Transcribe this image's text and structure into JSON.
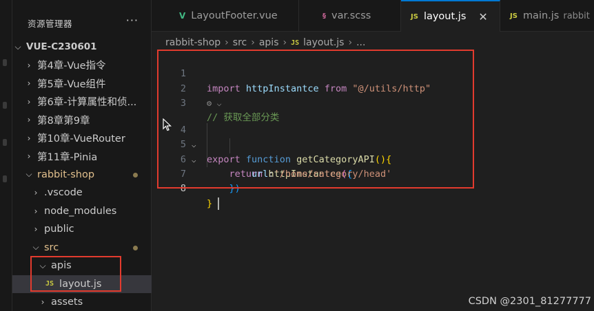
{
  "sidebar": {
    "title": "资源管理器",
    "more": "···",
    "project": "VUE-C230601",
    "items": [
      {
        "label": "第4章-Vue指令"
      },
      {
        "label": "第5章-Vue组件"
      },
      {
        "label": "第6章-计算属性和侦..."
      },
      {
        "label": "第8章第9章"
      },
      {
        "label": "第10章-VueRouter"
      },
      {
        "label": "第11章-Pinia"
      },
      {
        "label": "rabbit-shop"
      },
      {
        "label": ".vscode"
      },
      {
        "label": "node_modules"
      },
      {
        "label": "public"
      },
      {
        "label": "src"
      },
      {
        "label": "apis"
      },
      {
        "label": "layout.js"
      },
      {
        "label": "assets"
      }
    ]
  },
  "tabs": [
    {
      "label": "LayoutFooter.vue",
      "icon": "V"
    },
    {
      "label": "var.scss",
      "icon": "scss"
    },
    {
      "label": "layout.js",
      "icon": "JS",
      "close": "✕"
    },
    {
      "label": "main.js",
      "icon": "JS",
      "desc": "rabbit"
    }
  ],
  "breadcrumb": [
    "rabbit-shop",
    "src",
    "apis",
    "layout.js",
    "..."
  ],
  "code": {
    "line_numbers": [
      "1",
      "2",
      "3",
      "4",
      "5",
      "6",
      "7",
      "8"
    ],
    "l1": {
      "kw": "import",
      "id": "httpInstantce",
      "from": "from",
      "str": "\"@/utils/http\""
    },
    "l3": {
      "comment": "// 获取全部分类"
    },
    "l4": {
      "kw1": "export",
      "kw2": "function",
      "fn": "getCategoryAPI",
      "paren": "()",
      "brace": "{"
    },
    "l5": {
      "kw": "return",
      "fn": "httpInstantce",
      "paren": "(",
      "brace": "{"
    },
    "l6": {
      "key": "url",
      "colon": ":",
      "str": "'/home/category/head'"
    },
    "l7": {
      "close": "})"
    },
    "l8": {
      "brace": "}"
    }
  },
  "watermark": "CSDN @2301_81277777",
  "colors": {
    "accent": "#0078d4",
    "highlight_box": "#e33b2e",
    "js_icon": "#cbcb41"
  }
}
